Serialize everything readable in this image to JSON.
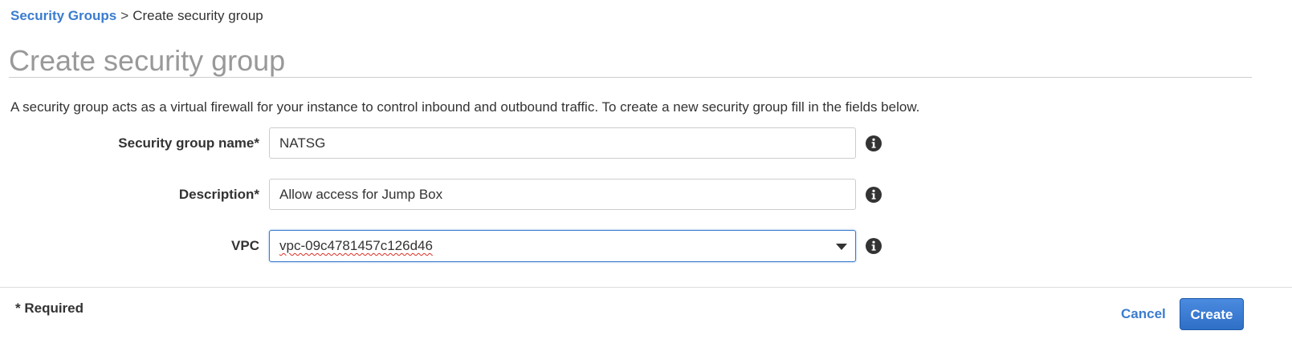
{
  "breadcrumb": {
    "parent": "Security Groups",
    "separator": ">",
    "current": "Create security group"
  },
  "page": {
    "title": "Create security group",
    "intro": "A security group acts as a virtual firewall for your instance to control inbound and outbound traffic. To create a new security group fill in the fields below."
  },
  "form": {
    "name": {
      "label": "Security group name*",
      "value": "NATSG"
    },
    "description": {
      "label": "Description*",
      "value": "Allow access for Jump Box"
    },
    "vpc": {
      "label": "VPC",
      "selected": "vpc-09c4781457c126d46"
    }
  },
  "footer": {
    "required_note": "* Required",
    "cancel_label": "Cancel",
    "create_label": "Create"
  },
  "icons": {
    "info": "info-icon",
    "dropdown": "chevron-down-icon"
  },
  "colors": {
    "link": "#3b7ccf",
    "primary_button": "#2f6fc6",
    "title": "#999999",
    "text": "#333333"
  }
}
